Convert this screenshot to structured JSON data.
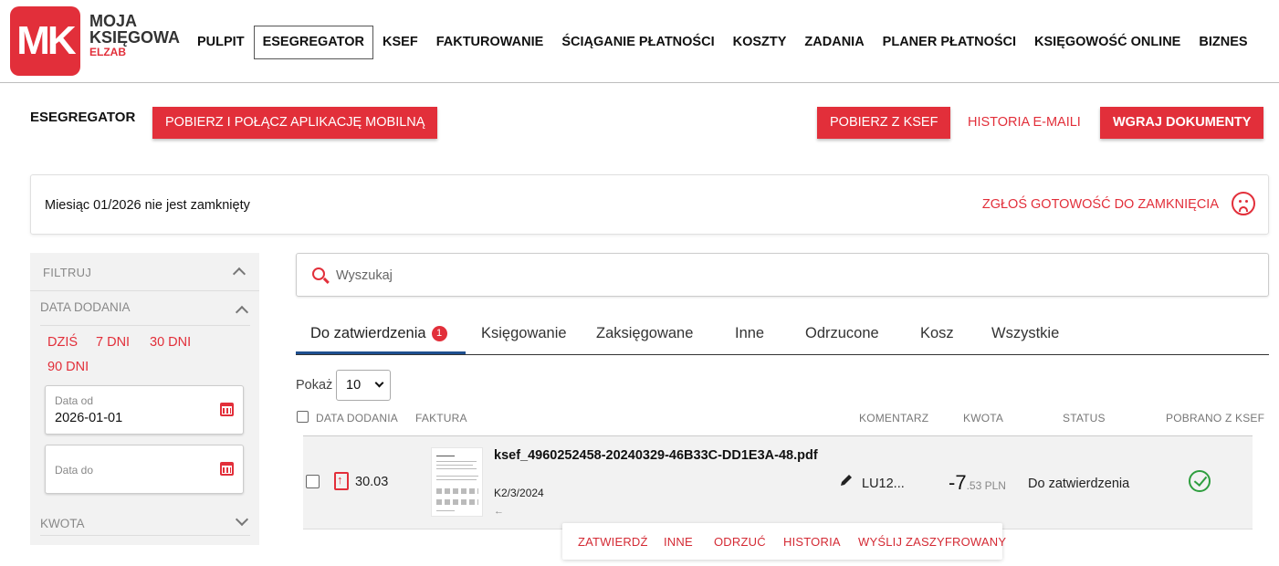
{
  "brand": {
    "logo": "MK",
    "line1": "MOJA",
    "line2": "KSIĘGOWA",
    "sub": "ELZAB",
    "accent": "#e22f3a"
  },
  "menu": [
    "PULPIT",
    "ESEGREGATOR",
    "KSEF",
    "FAKTUROWANIE",
    "ŚCIĄGANIE PŁATNOŚCI",
    "KOSZTY",
    "ZADANIA",
    "PLANER PŁATNOŚCI",
    "KSIĘGOWOŚĆ ONLINE",
    "BIZNES"
  ],
  "active_menu": "ESEGREGATOR",
  "header": {
    "title": "ESEGREGATOR",
    "mobile_button": "POBIERZ I POŁĄCZ APLIKACJĘ MOBILNĄ",
    "ksef_button": "POBIERZ Z KSEF",
    "email_history": "HISTORIA E-MAILI",
    "upload_button": "WGRAJ DOKUMENTY"
  },
  "notice": {
    "text": "Miesiąc 01/2026 nie jest zamknięty",
    "action": "ZGŁOŚ GOTOWOŚĆ DO ZAMKNIĘCIA"
  },
  "filter": {
    "title": "FILTRUJ",
    "date_section": "DATA DODANIA",
    "quick": [
      "DZIŚ",
      "7 DNI",
      "30 DNI",
      "90 DNI"
    ],
    "date_from_label": "Data od",
    "date_from_value": "2026-01-01",
    "date_to_label": "Data do",
    "amount_section": "KWOTA"
  },
  "search": {
    "placeholder": "Wyszukaj"
  },
  "tabs": [
    {
      "label": "Do zatwierdzenia",
      "badge": "1"
    },
    {
      "label": "Księgowanie"
    },
    {
      "label": "Zaksięgowane"
    },
    {
      "label": "Inne"
    },
    {
      "label": "Odrzucone"
    },
    {
      "label": "Kosz"
    },
    {
      "label": "Wszystkie"
    }
  ],
  "pagination": {
    "show_label": "Pokaż",
    "page_size": "10"
  },
  "table": {
    "headers": {
      "date": "DATA DODANIA",
      "invoice": "FAKTURA",
      "comment": "KOMENTARZ",
      "amount": "KWOTA",
      "status": "STATUS",
      "ksef": "POBRANO Z KSEF"
    },
    "rows": [
      {
        "date": "30.03",
        "file_name": "ksef_4960252458-20240329-46B33C-DD1E3A-48.pdf",
        "code": "K2/3/2024",
        "arrow": "←",
        "comment": "LU12...",
        "amount_main": "-7",
        "amount_rest": ".53 PLN",
        "status": "Do zatwierdzenia",
        "ksef_icon": "check-circle-icon"
      }
    ]
  },
  "row_actions": [
    "ZATWIERDŹ",
    "INNE",
    "ODRZUĆ",
    "HISTORIA",
    "WYŚLIJ ZASZYFROWANY"
  ]
}
